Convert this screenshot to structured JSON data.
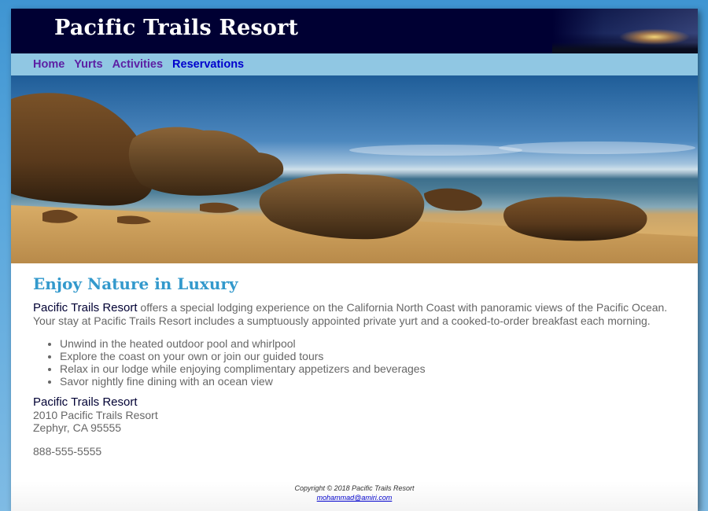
{
  "header": {
    "title": "Pacific Trails Resort"
  },
  "nav": {
    "items": [
      {
        "label": "Home"
      },
      {
        "label": "Yurts"
      },
      {
        "label": "Activities"
      },
      {
        "label": "Reservations"
      }
    ]
  },
  "main": {
    "heading": "Enjoy Nature in Luxury",
    "intro_name": "Pacific Trails Resort",
    "intro_text": " offers a special lodging experience on the California North Coast with panoramic views of the Pacific Ocean. Your stay at Pacific Trails Resort includes a sumptuously appointed private yurt and a cooked-to-order breakfast each morning.",
    "features": [
      "Unwind in the heated outdoor pool and whirlpool",
      "Explore the coast on your own or join our guided tours",
      "Relax in our lodge while enjoying complimentary appetizers and beverages",
      "Savor nightly fine dining with an ocean view"
    ],
    "contact": {
      "name": "Pacific Trails Resort",
      "street": "2010 Pacific Trails Resort",
      "city": "Zephyr, CA 95555",
      "phone": "888-555-5555"
    }
  },
  "footer": {
    "copyright": "Copyright © 2018 Pacific Trails Resort",
    "email": "mohammad@amiri.com"
  },
  "colors": {
    "header_bg": "#000033",
    "nav_bg": "#90c7e3",
    "nav_link": "#5c1fa3",
    "heading": "#3399cc",
    "text": "#666666",
    "page_bg": "#4a9fd8"
  }
}
